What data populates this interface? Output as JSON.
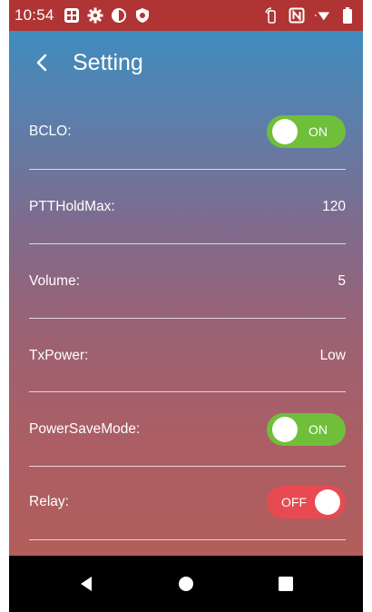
{
  "status_bar": {
    "time": "10:54",
    "left_icons": [
      "app-icon",
      "gear-icon",
      "half-circle-icon",
      "shield-icon"
    ],
    "right_icons": [
      "nfc-tap-icon",
      "nfc-icon",
      "wifi-icon",
      "battery-icon"
    ]
  },
  "header": {
    "title": "Setting",
    "back_icon": "back-arrow-icon"
  },
  "settings": [
    {
      "label": "BCLO:",
      "type": "toggle",
      "state": "on",
      "text": "ON"
    },
    {
      "label": "PTTHoldMax:",
      "type": "value",
      "value": "120"
    },
    {
      "label": "Volume:",
      "type": "value",
      "value": "5"
    },
    {
      "label": "TxPower:",
      "type": "value",
      "value": "Low"
    },
    {
      "label": "PowerSaveMode:",
      "type": "toggle",
      "state": "on",
      "text": "ON"
    },
    {
      "label": "Relay:",
      "type": "toggle",
      "state": "off",
      "text": "OFF"
    }
  ],
  "nav_bar": {
    "buttons": [
      "back-triangle-icon",
      "home-circle-icon",
      "recents-square-icon"
    ]
  },
  "colors": {
    "status_bar": "#b03434",
    "toggle_on": "#6fbf3a",
    "toggle_off": "#e84a52",
    "gradient_top": "#3f8cbf",
    "gradient_bottom": "#b25e5c"
  }
}
